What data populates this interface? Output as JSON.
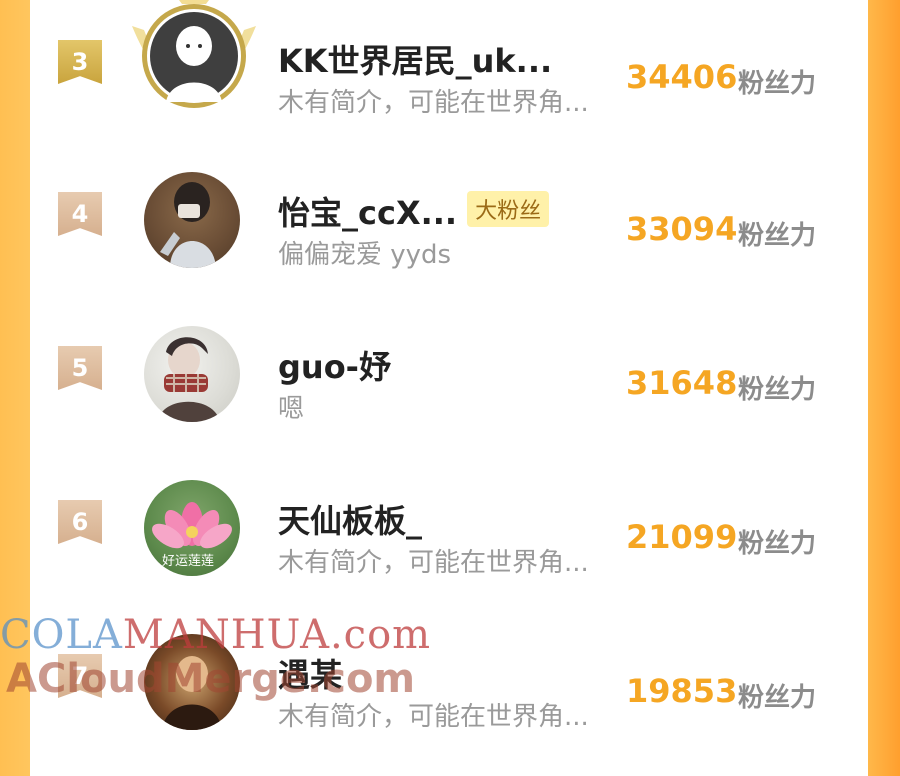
{
  "colors": {
    "accent_score": "#f5a623",
    "left_edge": "#ffc65e",
    "right_edge": "#ff9f2e",
    "gold_rank": "#c9a43d",
    "tan_rank": "#d6b08f"
  },
  "rows": [
    {
      "rank": "3",
      "name": "KK世界居民_uk...",
      "bio": "木有简介，可能在世界角...",
      "score": "34406",
      "score_label": "粉丝力",
      "badge": ""
    },
    {
      "rank": "4",
      "name": "怡宝_ccX...",
      "bio": "偏偏宠爱 yyds",
      "score": "33094",
      "score_label": "粉丝力",
      "badge": "大粉丝"
    },
    {
      "rank": "5",
      "name": "guo-妤",
      "bio": "嗯",
      "score": "31648",
      "score_label": "粉丝力",
      "badge": ""
    },
    {
      "rank": "6",
      "name": "天仙板板_",
      "bio": "木有简介，可能在世界角...",
      "score": "21099",
      "score_label": "粉丝力",
      "badge": "",
      "avatar_text": "好运莲莲"
    },
    {
      "rank": "7",
      "name": "遇某",
      "bio": "木有简介，可能在世界角...",
      "score": "19853",
      "score_label": "粉丝力",
      "badge": ""
    }
  ],
  "watermark": {
    "line1_part1": "COLA",
    "line1_part2": "MANHUA.com",
    "line2": "ACloudMerge.com"
  }
}
